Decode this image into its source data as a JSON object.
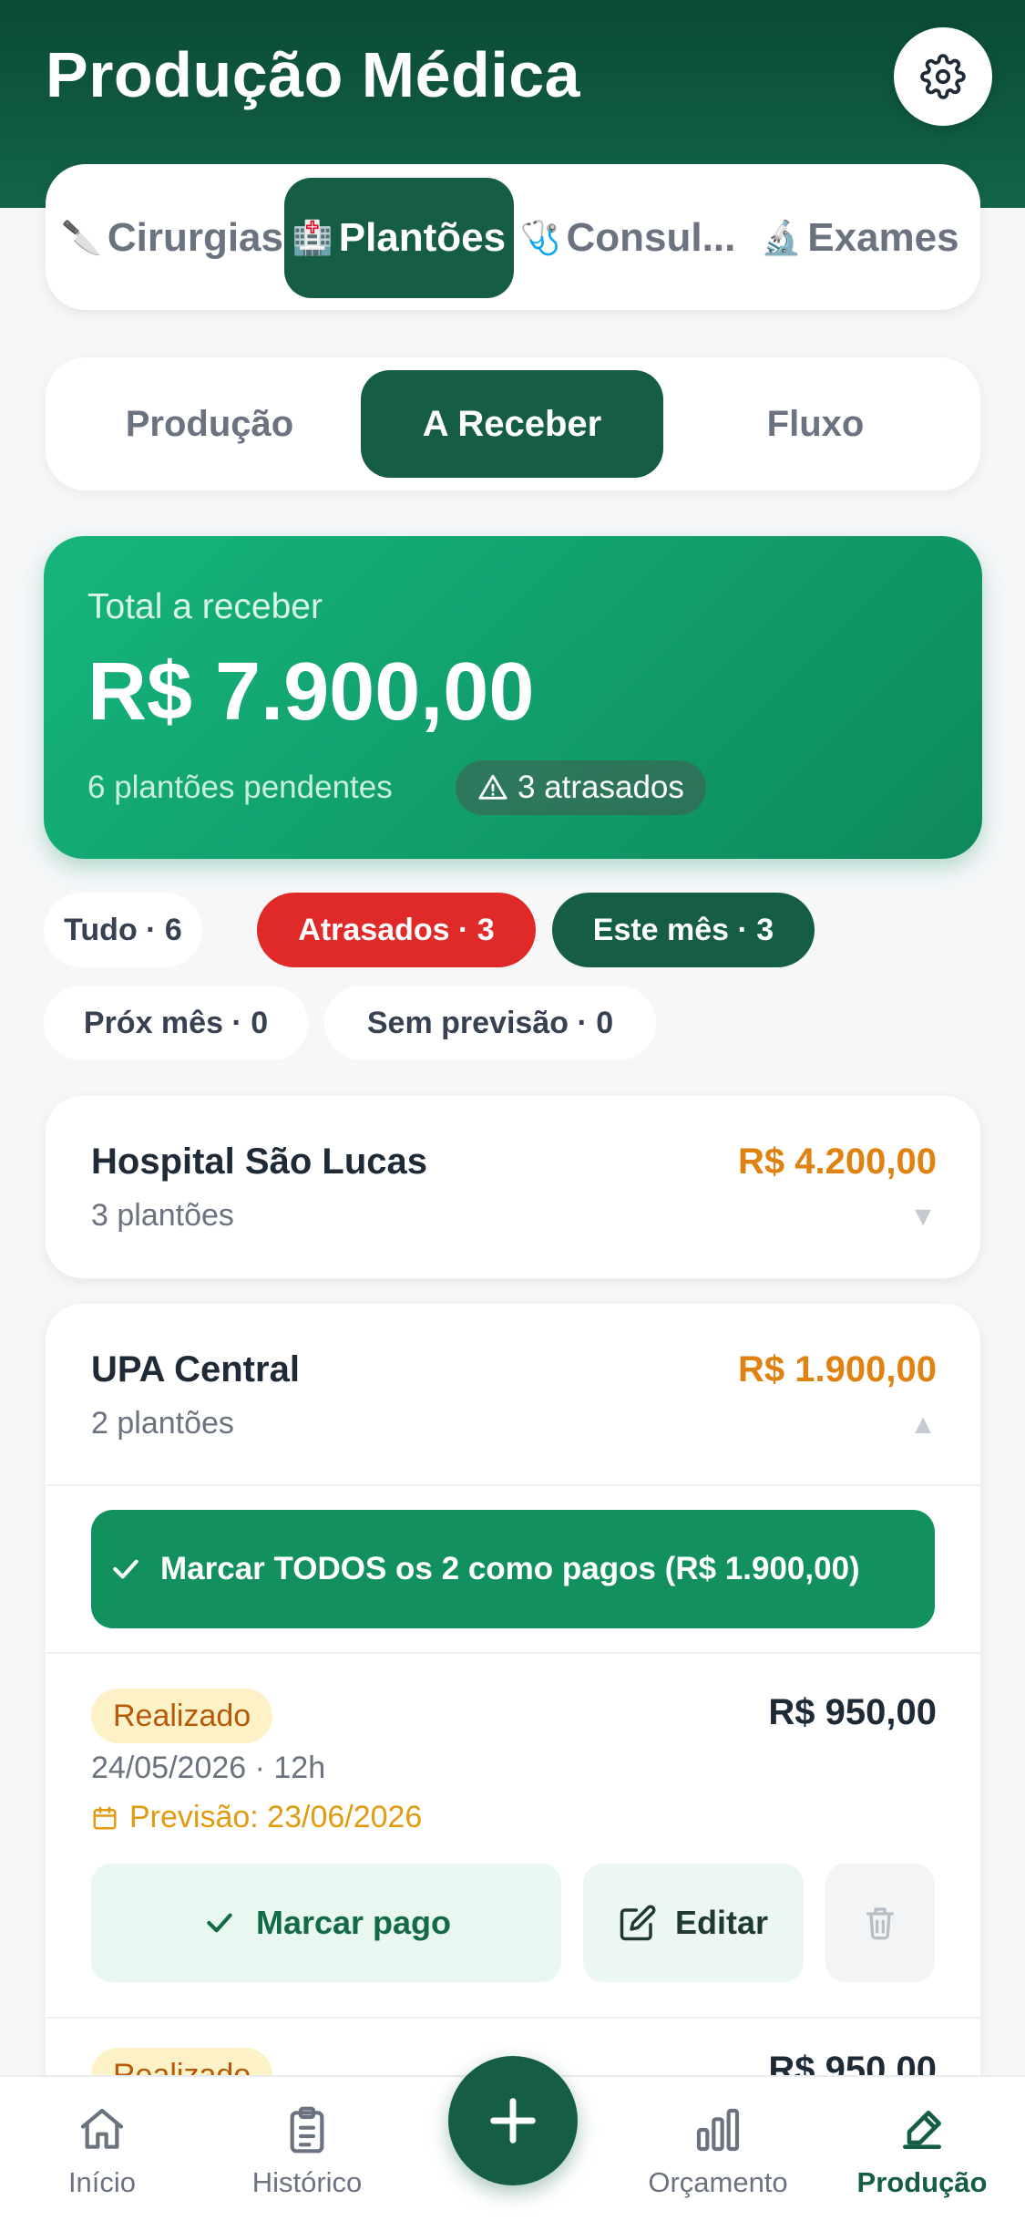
{
  "header": {
    "title": "Produção Médica"
  },
  "categories": [
    {
      "label": "Cirurgias",
      "emoji": "🔪",
      "active": false
    },
    {
      "label": "Plantões",
      "emoji": "🏥",
      "active": true
    },
    {
      "label": "Consul...",
      "emoji": "🩺",
      "active": false
    },
    {
      "label": "Exames",
      "emoji": "🔬",
      "active": false
    }
  ],
  "segments": [
    {
      "label": "Produção",
      "active": false
    },
    {
      "label": "A Receber",
      "active": true
    },
    {
      "label": "Fluxo",
      "active": false
    }
  ],
  "summary": {
    "label": "Total a receber",
    "value": "R$ 7.900,00",
    "pending": "6 plantões pendentes",
    "late": "3 atrasados"
  },
  "filters": [
    {
      "label": "Tudo · 6",
      "style": "plain"
    },
    {
      "label": "Atrasados · 3",
      "style": "red"
    },
    {
      "label": "Este mês · 3",
      "style": "dark"
    },
    {
      "label": "Próx mês · 0",
      "style": "plain"
    },
    {
      "label": "Sem previsão · 0",
      "style": "plain"
    }
  ],
  "groups": [
    {
      "name": "Hospital São Lucas",
      "count": "3 plantões",
      "amount": "R$ 4.200,00",
      "toggle": "▼"
    },
    {
      "name": "UPA Central",
      "count": "2 plantões",
      "amount": "R$ 1.900,00",
      "toggle": "▲",
      "mark_all": "Marcar TODOS os 2 como pagos (R$ 1.900,00)",
      "items": [
        {
          "status": "Realizado",
          "amount": "R$ 950,00",
          "date": "24/05/2026 · 12h",
          "forecast": "Previsão: 23/06/2026",
          "pay_label": "Marcar pago",
          "edit_label": "Editar"
        },
        {
          "status": "Realizado",
          "amount": "R$ 950,00"
        }
      ]
    }
  ],
  "nav": [
    {
      "label": "Início",
      "icon": "home-icon",
      "active": false
    },
    {
      "label": "Histórico",
      "icon": "clipboard-icon",
      "active": false
    },
    {
      "label": "Orçamento",
      "icon": "bar-chart-icon",
      "active": false
    },
    {
      "label": "Produção",
      "icon": "edit-pen-icon",
      "active": true
    }
  ],
  "fab": {
    "icon": "plus-icon"
  },
  "colors": {
    "primary": "#155e45",
    "accent": "#12915e",
    "warning": "#e08212",
    "danger": "#e02a2a"
  }
}
